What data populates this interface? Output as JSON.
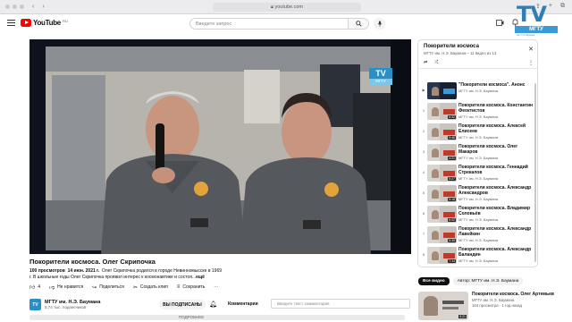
{
  "browser": {
    "url": "youtube.com",
    "back_icon": "‹",
    "forward_icon": "›"
  },
  "header": {
    "logo_text": "YouTube",
    "logo_region": "RU",
    "search_placeholder": "Введите запрос"
  },
  "video": {
    "title": "Покорители космоса. Олег Скрипочка",
    "views": "100 просмотров",
    "date": "14 июн. 2021 г.",
    "desc_line1": "Олег Скрипочка родился в городе Невинномысске в 1969",
    "desc_line2": "г. В школьные годы Олег Скрипочка проявил интерес к космонавтике и состоя...",
    "desc_more": "ещё",
    "overlay_tv": "TV",
    "overlay_mgtu": "МГТУ"
  },
  "actions": {
    "likes": "4",
    "dislike_label": "Не нравится",
    "share_label": "Поделиться",
    "clip_label": "Создать клип",
    "save_label": "Сохранить",
    "more_label": "···"
  },
  "channel": {
    "avatar_text": "TV",
    "name": "МГТУ им. Н.Э. Баумана",
    "subs": "5,74 тыс. подписчиков",
    "subscribe_label": "ВЫ ПОДПИСАНЫ",
    "comments_label": "Комментарии",
    "comment_placeholder": "Введите текст комментария",
    "cut_text": "ПОДРОБНЕЕ"
  },
  "playlist": {
    "title": "Покорители космоса",
    "meta": "МГТУ им. Н.Э. Баумана – 11 видео из 13",
    "close_label": "✕",
    "loop_label": "⇄",
    "shuffle_label": "⤮",
    "items": [
      {
        "idx": "▶",
        "title": "\"Покорители космоса\". Анонс",
        "channel": "МГТУ им. Н.Э. Баумана",
        "duration": ""
      },
      {
        "idx": "1",
        "title": "Покорители космоса. Константин Феоктистов",
        "channel": "МГТУ им. Н.Э. Баумана",
        "duration": "6:32"
      },
      {
        "idx": "2",
        "title": "Покорители космоса. Алексей Елисеев",
        "channel": "МГТУ им. Н.Э. Баумана",
        "duration": "5:48"
      },
      {
        "idx": "3",
        "title": "Покорители космоса. Олег Макаров",
        "channel": "МГТУ им. Н.Э. Баумана",
        "duration": "4:21"
      },
      {
        "idx": "4",
        "title": "Покорители космоса. Геннадий Стрекалов",
        "channel": "МГТУ им. Н.Э. Баумана",
        "duration": "5:27"
      },
      {
        "idx": "5",
        "title": "Покорители космоса. Александр Александров",
        "channel": "МГТУ им. Н.Э. Баумана",
        "duration": "5:18"
      },
      {
        "idx": "6",
        "title": "Покорители космоса. Владимир Соловьёв",
        "channel": "МГТУ им. Н.Э. Баумана",
        "duration": "6:02"
      },
      {
        "idx": "7",
        "title": "Покорители космоса. Александр Лавейкин",
        "channel": "МГТУ им. Н.Э. Баумана",
        "duration": "5:36"
      },
      {
        "idx": "8",
        "title": "Покорители космоса. Александр Баландин",
        "channel": "МГТУ им. Н.Э. Баумана",
        "duration": "7:14"
      }
    ]
  },
  "chips": [
    "Все видео",
    "Автор: МГТУ им. Н.Э. Баумана"
  ],
  "recommendation": {
    "title": "Покорители космоса. Олег Артемьев",
    "channel": "МГТУ им. Н.Э. Баумана",
    "stats": "164 просмотра · 1 год назад",
    "duration": "5:21"
  },
  "corner_logo": {
    "tv": "TV",
    "band": "МГТУ",
    "sub": "им. Н.Э. Баумана"
  }
}
